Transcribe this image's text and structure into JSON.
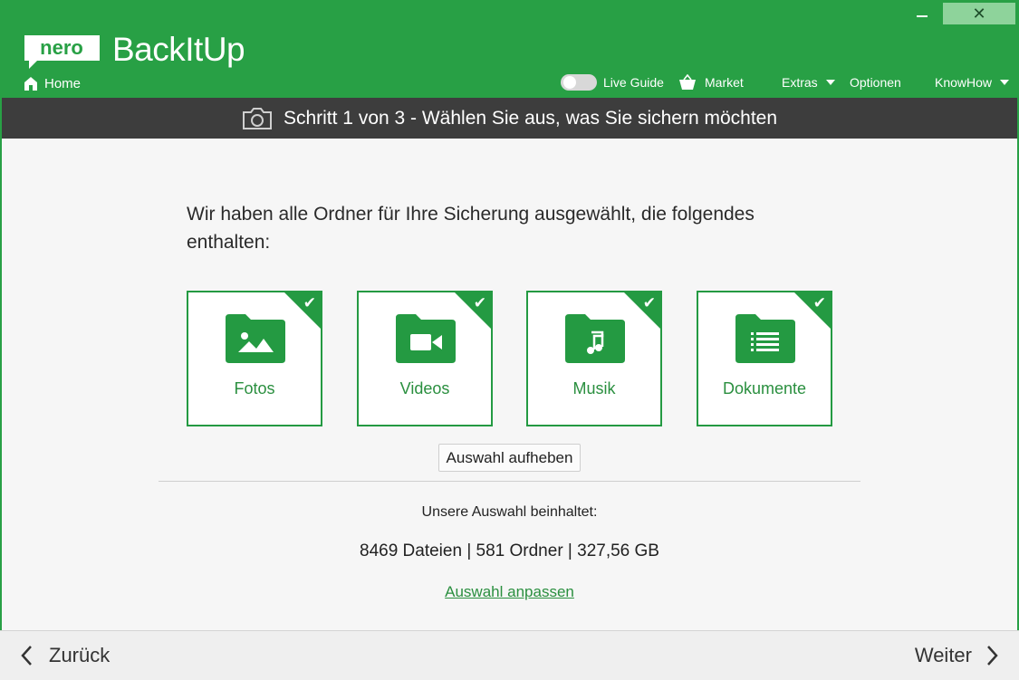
{
  "window": {
    "minimize_icon": "minimize-icon",
    "close_label": "✕"
  },
  "header": {
    "logo_text": "nero",
    "app_title": "BackItUp",
    "home_label": "Home",
    "live_guide_label": "Live Guide",
    "market_label": "Market",
    "extras_label": "Extras",
    "options_label": "Optionen",
    "knowhow_label": "KnowHow"
  },
  "stepbar": {
    "title": "Schritt 1 von 3 - Wählen Sie aus, was Sie sichern möchten"
  },
  "main": {
    "intro": "Wir haben alle Ordner für Ihre Sicherung ausgewählt, die folgendes enthalten:",
    "tiles": [
      {
        "label": "Fotos",
        "icon": "photo-folder-icon",
        "checked": true
      },
      {
        "label": "Videos",
        "icon": "video-folder-icon",
        "checked": true
      },
      {
        "label": "Musik",
        "icon": "music-folder-icon",
        "checked": true
      },
      {
        "label": "Dokumente",
        "icon": "document-folder-icon",
        "checked": true
      }
    ],
    "deselect_label": "Auswahl aufheben",
    "summary_label": "Unsere Auswahl beinhaltet:",
    "summary_stats": "8469 Dateien | 581 Ordner | 327,56 GB",
    "adjust_label": "Auswahl anpassen"
  },
  "footer": {
    "back_label": "Zurück",
    "next_label": "Weiter"
  },
  "colors": {
    "brand_green": "#28a045",
    "tile_green": "#249a42",
    "stepbar_dark": "#3d3d3d"
  }
}
